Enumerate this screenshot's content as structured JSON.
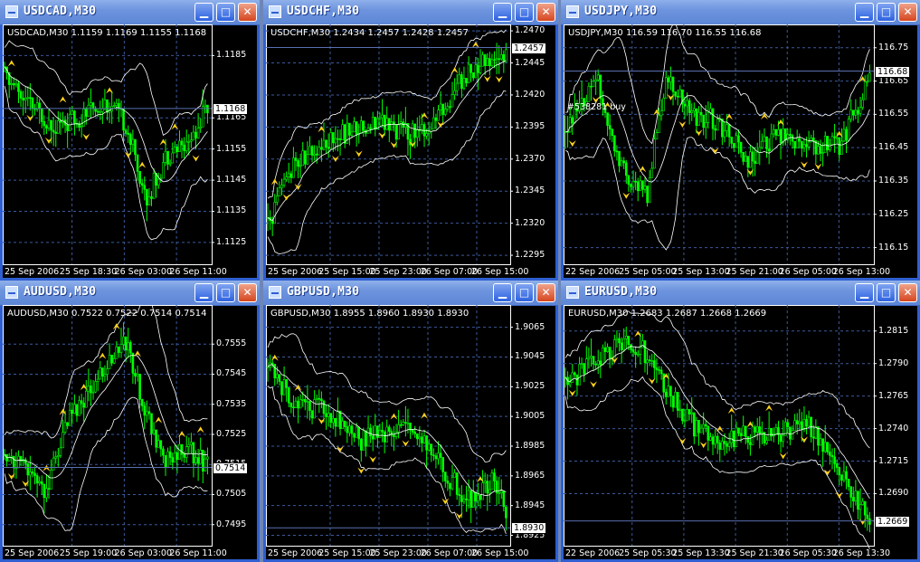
{
  "windows": [
    {
      "title": "USDCAD,M30",
      "info": "USDCAD,M30  1.1159 1.1169 1.1155 1.1168",
      "ylabels": [
        "1.1185",
        "1.1165",
        "1.1145",
        "1.1125",
        "1.1155",
        "1.1135"
      ],
      "yticks": [
        1.1185,
        1.1165,
        1.1145,
        1.1125,
        1.1155,
        1.1135
      ],
      "ylim": [
        1.1118,
        1.1195
      ],
      "current": "1.1168",
      "current_value": 1.1168,
      "xlabels": [
        "25 Sep 2006",
        "25 Sep 18:30",
        "26 Sep 03:00",
        "26 Sep 11:00"
      ],
      "annotation": ""
    },
    {
      "title": "USDCHF,M30",
      "info": "USDCHF,M30  1.2434 1.2457 1.2428 1.2457",
      "ylabels": [
        "1.2470",
        "1.2445",
        "1.2420",
        "1.2395",
        "1.2370",
        "1.2345",
        "1.2320",
        "1.2295"
      ],
      "yticks": [
        1.247,
        1.2445,
        1.242,
        1.2395,
        1.237,
        1.2345,
        1.232,
        1.2295
      ],
      "ylim": [
        1.2288,
        1.2475
      ],
      "current": "1.2457",
      "current_value": 1.2457,
      "xlabels": [
        "25 Sep 2006",
        "25 Sep 15:00",
        "25 Sep 23:00",
        "26 Sep 07:00",
        "26 Sep 15:00"
      ],
      "annotation": ""
    },
    {
      "title": "USDJPY,M30",
      "info": "USDJPY,M30  116.59 116.70 116.55 116.68",
      "ylabels": [
        "116.75",
        "116.65",
        "116.55",
        "116.45",
        "116.35",
        "116.25",
        "116.15"
      ],
      "yticks": [
        116.75,
        116.65,
        116.55,
        116.45,
        116.35,
        116.25,
        116.15
      ],
      "ylim": [
        116.1,
        116.82
      ],
      "current": "116.68",
      "current_value": 116.68,
      "xlabels": [
        "22 Sep 2006",
        "25 Sep 05:00",
        "25 Sep 13:00",
        "25 Sep 21:00",
        "26 Sep 05:00",
        "26 Sep 13:00"
      ],
      "annotation": "#538281 buy"
    },
    {
      "title": "AUDUSD,M30",
      "info": "AUDUSD,M30  0.7522 0.7522 0.7514 0.7514",
      "ylabels": [
        "0.7555",
        "0.7545",
        "0.7535",
        "0.7525",
        "0.7515",
        "0.7505",
        "0.7495"
      ],
      "yticks": [
        0.7555,
        0.7545,
        0.7535,
        0.7525,
        0.7515,
        0.7505,
        0.7495
      ],
      "ylim": [
        0.7488,
        0.7568
      ],
      "current": "0.7514",
      "current_value": 0.7514,
      "xlabels": [
        "25 Sep 2006",
        "25 Sep 19:00",
        "26 Sep 03:00",
        "26 Sep 11:00"
      ],
      "annotation": ""
    },
    {
      "title": "GBPUSD,M30",
      "info": "GBPUSD,M30  1.8955 1.8960 1.8930 1.8930",
      "ylabels": [
        "1.9065",
        "1.9045",
        "1.9025",
        "1.9005",
        "1.8985",
        "1.8965",
        "1.8945",
        "1.8925"
      ],
      "yticks": [
        1.9065,
        1.9045,
        1.9025,
        1.9005,
        1.8985,
        1.8965,
        1.8945,
        1.8925
      ],
      "ylim": [
        1.8918,
        1.908
      ],
      "current": "1.8930",
      "current_value": 1.893,
      "xlabels": [
        "25 Sep 2006",
        "25 Sep 15:00",
        "25 Sep 23:00",
        "26 Sep 07:00",
        "26 Sep 15:00"
      ],
      "annotation": ""
    },
    {
      "title": "EURUSD,M30",
      "info": "EURUSD,M30  1.2683 1.2687 1.2668 1.2669",
      "ylabels": [
        "1.2815",
        "1.2790",
        "1.2765",
        "1.2740",
        "1.2715",
        "1.2690"
      ],
      "yticks": [
        1.2815,
        1.279,
        1.2765,
        1.274,
        1.2715,
        1.269
      ],
      "ylim": [
        1.265,
        1.2835
      ],
      "current": "1.2669",
      "current_value": 1.2669,
      "xlabels": [
        "22 Sep 2006",
        "25 Sep 05:30",
        "25 Sep 13:30",
        "25 Sep 21:30",
        "26 Sep 05:30",
        "26 Sep 13:30"
      ],
      "annotation": ""
    }
  ],
  "colors": {
    "candle": "#00ff00",
    "band": "#ffffff",
    "grid": "#3a5a9a",
    "fractal": "#ffd21a",
    "titlebar": "#6e94de"
  },
  "icons": {
    "minimize": "minimize-icon",
    "maximize": "maximize-icon",
    "close": "close-icon"
  }
}
